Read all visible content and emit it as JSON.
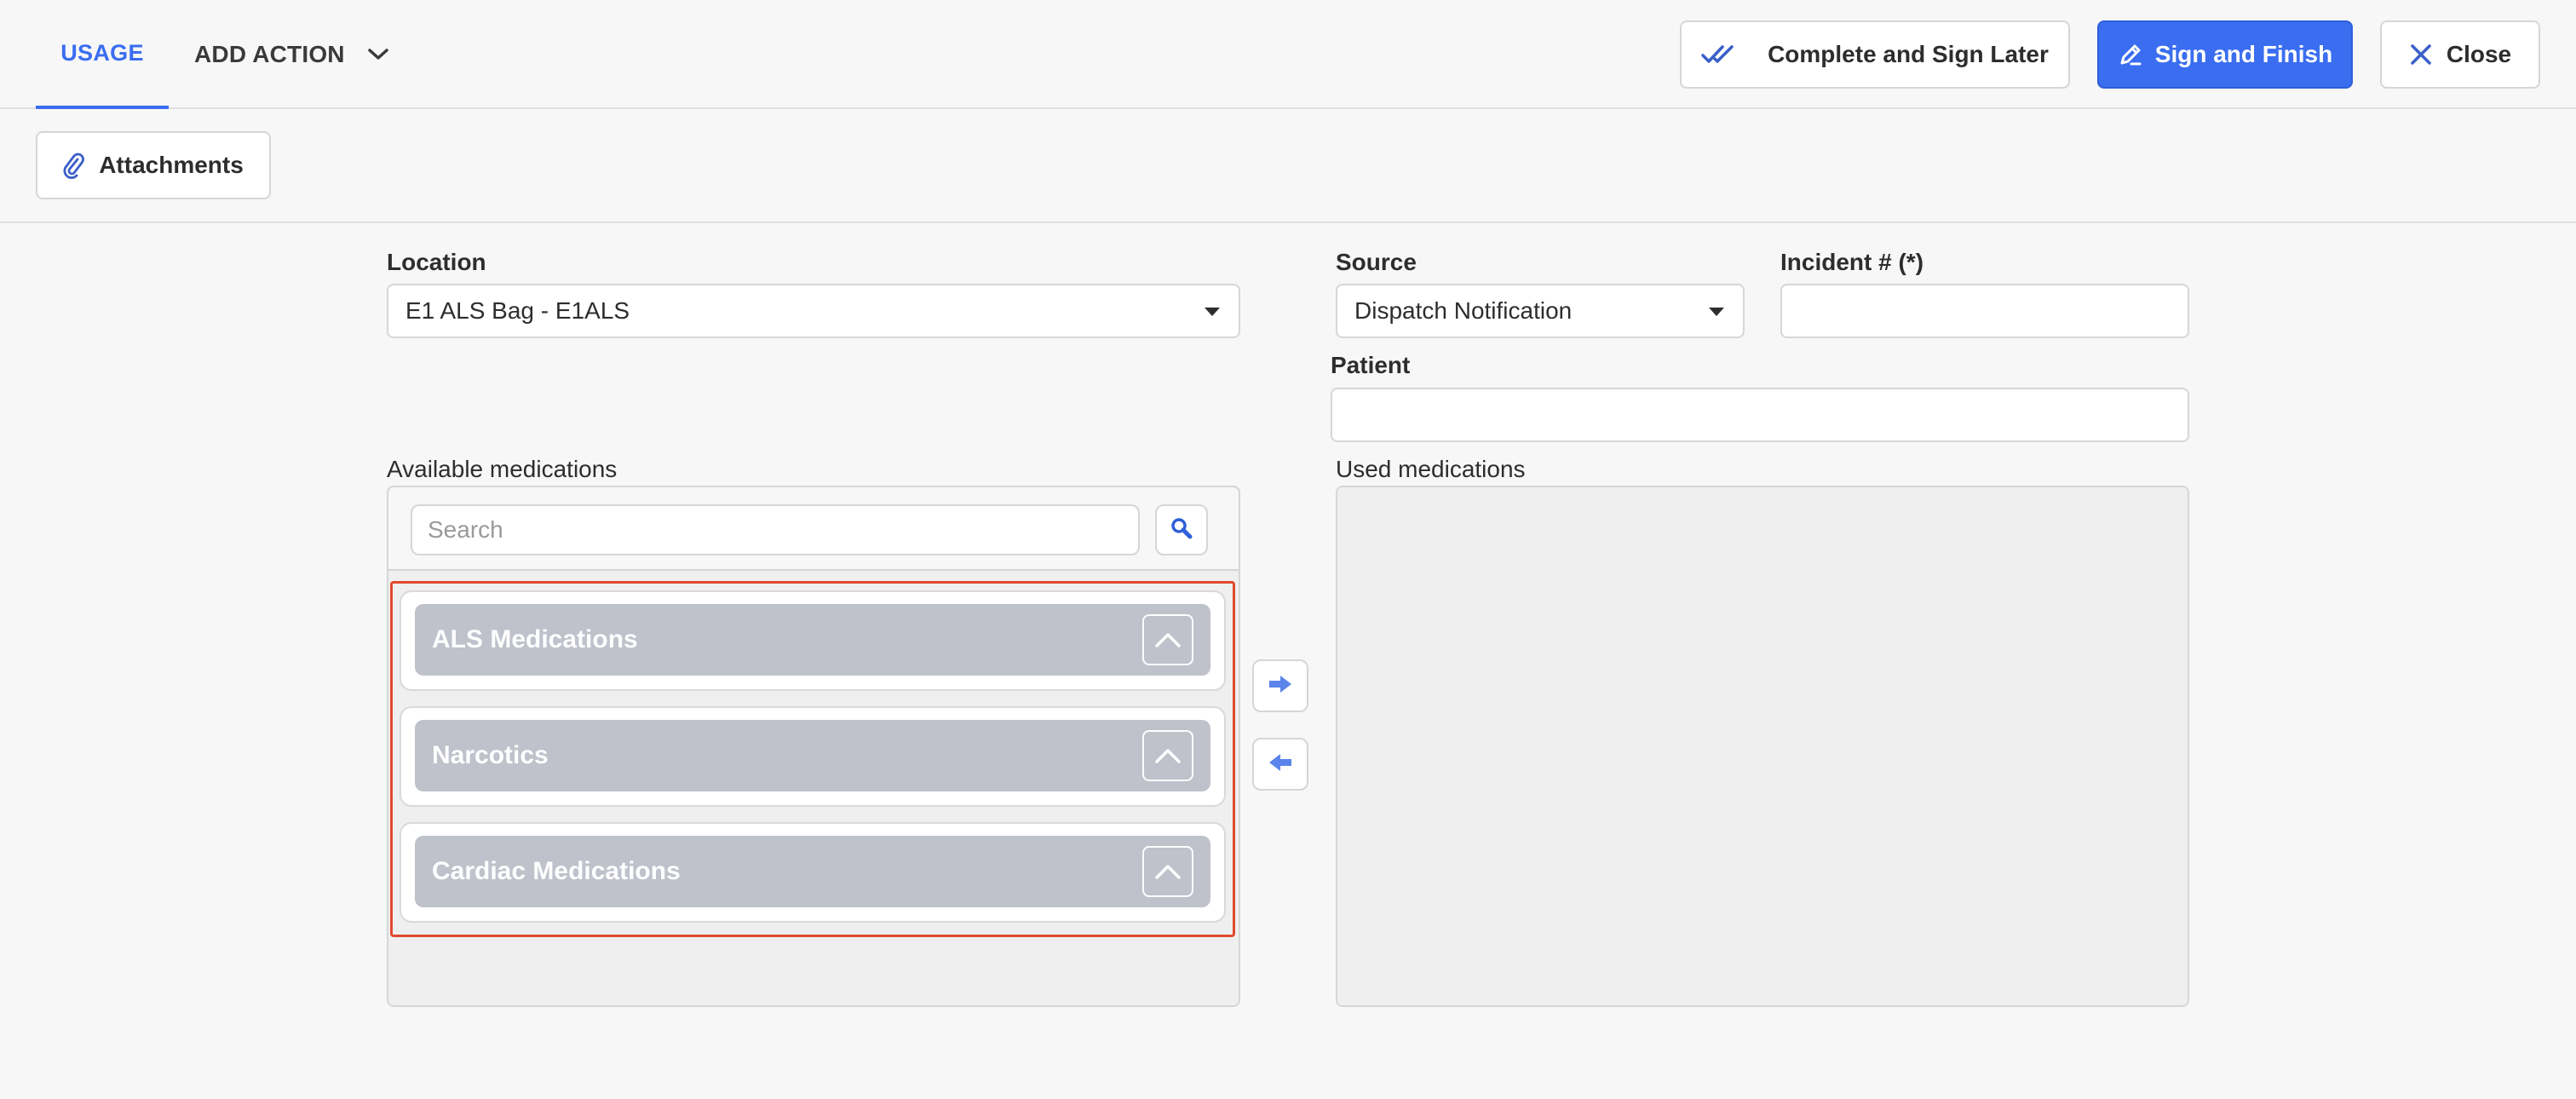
{
  "header": {
    "tabs": [
      {
        "label": "USAGE",
        "active": true
      },
      {
        "label": "ADD ACTION",
        "active": false
      }
    ],
    "buttons": {
      "sign_later": "Complete and Sign Later",
      "sign_finish": "Sign and Finish",
      "close": "Close"
    }
  },
  "toolbar": {
    "attachments": "Attachments"
  },
  "form": {
    "location": {
      "label": "Location",
      "value": "E1 ALS Bag - E1ALS"
    },
    "source": {
      "label": "Source",
      "value": "Dispatch Notification"
    },
    "incident": {
      "label": "Incident # (*)",
      "value": ""
    },
    "patient": {
      "label": "Patient",
      "value": ""
    }
  },
  "available": {
    "label": "Available medications",
    "search_placeholder": "Search",
    "groups": [
      {
        "label": "ALS Medications"
      },
      {
        "label": "Narcotics"
      },
      {
        "label": "Cardiac Medications"
      }
    ]
  },
  "used": {
    "label": "Used medications"
  },
  "colors": {
    "accent": "#3a6df0",
    "group_bar": "#bfc1cb",
    "highlight_border": "#e04a2f"
  },
  "icons": {
    "add_action_toggle": "chevron-down-icon",
    "sign_later": "double-check-icon",
    "sign_finish": "pen-icon",
    "close": "close-icon",
    "attachments": "paperclip-icon",
    "search": "search-icon",
    "group_toggle": "chevron-up-icon",
    "move_right": "arrow-right-icon",
    "move_left": "arrow-left-icon"
  }
}
